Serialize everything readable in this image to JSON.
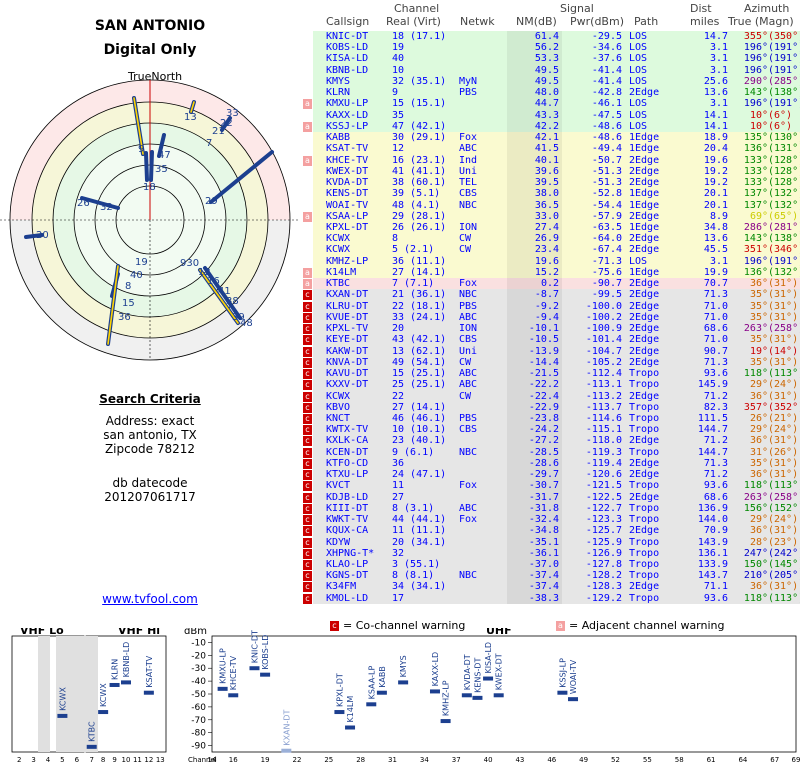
{
  "left": {
    "title": "SAN ANTONIO",
    "subtitle": "Digital Only",
    "true_north": "TrueNorth",
    "n_label": "N",
    "search_criteria_label": "Search Criteria",
    "address_line": "Address: exact",
    "city_line": "san antonio, TX",
    "zip_line": "Zipcode 78212",
    "db_label": "db datecode",
    "db_value": "201207061717",
    "link": "www.tvfool.com"
  },
  "polar": {
    "labels": [
      "13",
      "33",
      "22",
      "21",
      "7",
      "9",
      "47",
      "35",
      "18",
      "29",
      "26",
      "32",
      "20",
      "19",
      "40",
      "8",
      "15",
      "36",
      "930",
      "12",
      "16",
      "41",
      "38",
      "39",
      "48"
    ]
  },
  "header": {
    "channel": "Channel",
    "signal": "Signal",
    "dist": "Dist",
    "azimuth": "Azimuth",
    "callsign": "Callsign",
    "real_virt": "Real (Virt)",
    "netwk": "Netwk",
    "nm": "NM(dB)",
    "pwr": "Pwr(dBm)",
    "path": "Path",
    "miles": "miles",
    "true_magn": "True (Magn)"
  },
  "colors": {
    "green": "#ddfadd",
    "yellow": "#fafad0",
    "pink": "#fae0e0",
    "gray": "#e6e6e6",
    "warn_c": "#cc0000",
    "warn_a": "#f4a0a0"
  },
  "rows": [
    {
      "w": "",
      "bg": "green",
      "cs": "KNIC-DT",
      "ch": "18 (17.1)",
      "nw": "",
      "nm": "61.4",
      "pw": "-29.5",
      "pt": "LOS",
      "mi": "14.7",
      "az": "355°",
      "mg": "(350°)",
      "azc": "#c00"
    },
    {
      "w": "",
      "bg": "green",
      "cs": "KOBS-LD",
      "ch": "19",
      "nw": "",
      "nm": "56.2",
      "pw": "-34.6",
      "pt": "LOS",
      "mi": "3.1",
      "az": "196°",
      "mg": "(191°)",
      "azc": "#00c"
    },
    {
      "w": "",
      "bg": "green",
      "cs": "KISA-LD",
      "ch": "40",
      "nw": "",
      "nm": "53.3",
      "pw": "-37.6",
      "pt": "LOS",
      "mi": "3.1",
      "az": "196°",
      "mg": "(191°)",
      "azc": "#00c"
    },
    {
      "w": "",
      "bg": "green",
      "cs": "KBNB-LD",
      "ch": "10",
      "nw": "",
      "nm": "49.5",
      "pw": "-41.4",
      "pt": "LOS",
      "mi": "3.1",
      "az": "196°",
      "mg": "(191°)",
      "azc": "#00c"
    },
    {
      "w": "",
      "bg": "green",
      "cs": "KMYS",
      "ch": "32 (35.1)",
      "nw": "MyN",
      "nm": "49.5",
      "pw": "-41.4",
      "pt": "LOS",
      "mi": "25.6",
      "az": "290°",
      "mg": "(285°)",
      "azc": "#808"
    },
    {
      "w": "",
      "bg": "green",
      "cs": "KLRN",
      "ch": "9",
      "nw": "PBS",
      "nm": "48.0",
      "pw": "-42.8",
      "pt": "2Edge",
      "mi": "13.6",
      "az": "143°",
      "mg": "(138°)",
      "azc": "#080"
    },
    {
      "w": "a",
      "bg": "green",
      "cs": "KMXU-LP",
      "ch": "15 (15.1)",
      "nw": "",
      "nm": "44.7",
      "pw": "-46.1",
      "pt": "LOS",
      "mi": "3.1",
      "az": "196°",
      "mg": "(191°)",
      "azc": "#00c"
    },
    {
      "w": "",
      "bg": "green",
      "cs": "KAXX-LD",
      "ch": "35",
      "nw": "",
      "nm": "43.3",
      "pw": "-47.5",
      "pt": "LOS",
      "mi": "14.1",
      "az": "10°",
      "mg": "(6°)",
      "azc": "#c00"
    },
    {
      "w": "a",
      "bg": "green",
      "cs": "KSSJ-LP",
      "ch": "47 (42.1)",
      "nw": "",
      "nm": "42.2",
      "pw": "-48.6",
      "pt": "LOS",
      "mi": "14.1",
      "az": "10°",
      "mg": "(6°)",
      "azc": "#c00"
    },
    {
      "w": "",
      "bg": "yellow",
      "cs": "KABB",
      "ch": "30 (29.1)",
      "nw": "Fox",
      "nm": "42.1",
      "pw": "-48.6",
      "pt": "1Edge",
      "mi": "18.9",
      "az": "135°",
      "mg": "(130°)",
      "azc": "#080"
    },
    {
      "w": "",
      "bg": "yellow",
      "cs": "KSAT-TV",
      "ch": "12",
      "nw": "ABC",
      "nm": "41.5",
      "pw": "-49.4",
      "pt": "1Edge",
      "mi": "20.4",
      "az": "136°",
      "mg": "(131°)",
      "azc": "#080"
    },
    {
      "w": "a",
      "bg": "yellow",
      "cs": "KHCE-TV",
      "ch": "16 (23.1)",
      "nw": "Ind",
      "nm": "40.1",
      "pw": "-50.7",
      "pt": "2Edge",
      "mi": "19.6",
      "az": "133°",
      "mg": "(128°)",
      "azc": "#080"
    },
    {
      "w": "",
      "bg": "yellow",
      "cs": "KWEX-DT",
      "ch": "41 (41.1)",
      "nw": "Uni",
      "nm": "39.6",
      "pw": "-51.3",
      "pt": "2Edge",
      "mi": "19.2",
      "az": "133°",
      "mg": "(128°)",
      "azc": "#080"
    },
    {
      "w": "",
      "bg": "yellow",
      "cs": "KVDA-DT",
      "ch": "38 (60.1)",
      "nw": "TEL",
      "nm": "39.5",
      "pw": "-51.3",
      "pt": "2Edge",
      "mi": "19.2",
      "az": "133°",
      "mg": "(128°)",
      "azc": "#080"
    },
    {
      "w": "",
      "bg": "yellow",
      "cs": "KENS-DT",
      "ch": "39 (5.1)",
      "nw": "CBS",
      "nm": "38.0",
      "pw": "-52.8",
      "pt": "1Edge",
      "mi": "20.1",
      "az": "137°",
      "mg": "(132°)",
      "azc": "#080"
    },
    {
      "w": "",
      "bg": "yellow",
      "cs": "WOAI-TV",
      "ch": "48 (4.1)",
      "nw": "NBC",
      "nm": "36.5",
      "pw": "-54.4",
      "pt": "1Edge",
      "mi": "20.1",
      "az": "137°",
      "mg": "(132°)",
      "azc": "#080"
    },
    {
      "w": "a",
      "bg": "yellow",
      "cs": "KSAA-LP",
      "ch": "29 (28.1)",
      "nw": "",
      "nm": "33.0",
      "pw": "-57.9",
      "pt": "2Edge",
      "mi": "8.9",
      "az": "69°",
      "mg": "(65°)",
      "azc": "#cc0"
    },
    {
      "w": "",
      "bg": "yellow",
      "cs": "KPXL-DT",
      "ch": "26 (26.1)",
      "nw": "ION",
      "nm": "27.4",
      "pw": "-63.5",
      "pt": "1Edge",
      "mi": "34.8",
      "az": "286°",
      "mg": "(281°)",
      "azc": "#808"
    },
    {
      "w": "",
      "bg": "yellow",
      "cs": "KCWX",
      "ch": "8",
      "nw": "CW",
      "nm": "26.9",
      "pw": "-64.0",
      "pt": "2Edge",
      "mi": "13.6",
      "az": "143°",
      "mg": "(138°)",
      "azc": "#080"
    },
    {
      "w": "",
      "bg": "yellow",
      "cs": "KCWX",
      "ch": "5 (2.1)",
      "nw": "CW",
      "nm": "23.4",
      "pw": "-67.4",
      "pt": "2Edge",
      "mi": "45.5",
      "az": "351°",
      "mg": "(346°)",
      "azc": "#c00"
    },
    {
      "w": "",
      "bg": "yellow",
      "cs": "KMHZ-LP",
      "ch": "36 (11.1)",
      "nw": "",
      "nm": "19.6",
      "pw": "-71.3",
      "pt": "LOS",
      "mi": "3.1",
      "az": "196°",
      "mg": "(191°)",
      "azc": "#00c"
    },
    {
      "w": "a",
      "bg": "yellow",
      "cs": "K14LM",
      "ch": "27 (14.1)",
      "nw": "",
      "nm": "15.2",
      "pw": "-75.6",
      "pt": "1Edge",
      "mi": "19.9",
      "az": "136°",
      "mg": "(132°)",
      "azc": "#080"
    },
    {
      "w": "a",
      "bg": "pink",
      "cs": "KTBC",
      "ch": "7 (7.1)",
      "nw": "Fox",
      "nm": "0.2",
      "pw": "-90.7",
      "pt": "2Edge",
      "mi": "70.7",
      "az": "36°",
      "mg": "(31°)",
      "azc": "#c60"
    },
    {
      "w": "c",
      "bg": "gray",
      "cs": "KXAN-DT",
      "ch": "21 (36.1)",
      "nw": "NBC",
      "nm": "-8.7",
      "pw": "-99.5",
      "pt": "2Edge",
      "mi": "71.3",
      "az": "35°",
      "mg": "(31°)",
      "azc": "#c60"
    },
    {
      "w": "c",
      "bg": "gray",
      "cs": "KLRU-DT",
      "ch": "22 (18.1)",
      "nw": "PBS",
      "nm": "-9.2",
      "pw": "-100.0",
      "pt": "2Edge",
      "mi": "71.0",
      "az": "35°",
      "mg": "(31°)",
      "azc": "#c60"
    },
    {
      "w": "c",
      "bg": "gray",
      "cs": "KVUE-DT",
      "ch": "33 (24.1)",
      "nw": "ABC",
      "nm": "-9.4",
      "pw": "-100.2",
      "pt": "2Edge",
      "mi": "71.0",
      "az": "35°",
      "mg": "(31°)",
      "azc": "#c60"
    },
    {
      "w": "c",
      "bg": "gray",
      "cs": "KPXL-TV",
      "ch": "20",
      "nw": "ION",
      "nm": "-10.1",
      "pw": "-100.9",
      "pt": "2Edge",
      "mi": "68.6",
      "az": "263°",
      "mg": "(258°)",
      "azc": "#808"
    },
    {
      "w": "c",
      "bg": "gray",
      "cs": "KEYE-DT",
      "ch": "43 (42.1)",
      "nw": "CBS",
      "nm": "-10.5",
      "pw": "-101.4",
      "pt": "2Edge",
      "mi": "71.0",
      "az": "35°",
      "mg": "(31°)",
      "azc": "#c60"
    },
    {
      "w": "c",
      "bg": "gray",
      "cs": "KAKW-DT",
      "ch": "13 (62.1)",
      "nw": "Uni",
      "nm": "-13.9",
      "pw": "-104.7",
      "pt": "2Edge",
      "mi": "90.7",
      "az": "19°",
      "mg": "(14°)",
      "azc": "#c00"
    },
    {
      "w": "c",
      "bg": "gray",
      "cs": "KNVA-DT",
      "ch": "49 (54.1)",
      "nw": "CW",
      "nm": "-14.4",
      "pw": "-105.2",
      "pt": "2Edge",
      "mi": "71.3",
      "az": "35°",
      "mg": "(31°)",
      "azc": "#c60"
    },
    {
      "w": "c",
      "bg": "gray",
      "cs": "KAVU-DT",
      "ch": "15 (25.1)",
      "nw": "ABC",
      "nm": "-21.5",
      "pw": "-112.4",
      "pt": "Tropo",
      "mi": "93.6",
      "az": "118°",
      "mg": "(113°)",
      "azc": "#080"
    },
    {
      "w": "c",
      "bg": "gray",
      "cs": "KXXV-DT",
      "ch": "25 (25.1)",
      "nw": "ABC",
      "nm": "-22.2",
      "pw": "-113.1",
      "pt": "Tropo",
      "mi": "145.9",
      "az": "29°",
      "mg": "(24°)",
      "azc": "#c60"
    },
    {
      "w": "c",
      "bg": "gray",
      "cs": "KCWX",
      "ch": "22",
      "nw": "CW",
      "nm": "-22.4",
      "pw": "-113.2",
      "pt": "2Edge",
      "mi": "71.2",
      "az": "36°",
      "mg": "(31°)",
      "azc": "#c60"
    },
    {
      "w": "c",
      "bg": "gray",
      "cs": "KBVO",
      "ch": "27 (14.1)",
      "nw": "",
      "nm": "-22.9",
      "pw": "-113.7",
      "pt": "Tropo",
      "mi": "82.3",
      "az": "357°",
      "mg": "(352°)",
      "azc": "#c00"
    },
    {
      "w": "c",
      "bg": "gray",
      "cs": "KNCT",
      "ch": "46 (46.1)",
      "nw": "PBS",
      "nm": "-23.8",
      "pw": "-114.6",
      "pt": "Tropo",
      "mi": "111.5",
      "az": "26°",
      "mg": "(21°)",
      "azc": "#c60"
    },
    {
      "w": "c",
      "bg": "gray",
      "cs": "KWTX-TV",
      "ch": "10 (10.1)",
      "nw": "CBS",
      "nm": "-24.2",
      "pw": "-115.1",
      "pt": "Tropo",
      "mi": "144.7",
      "az": "29°",
      "mg": "(24°)",
      "azc": "#c60"
    },
    {
      "w": "c",
      "bg": "gray",
      "cs": "KXLK-CA",
      "ch": "23 (40.1)",
      "nw": "",
      "nm": "-27.2",
      "pw": "-118.0",
      "pt": "2Edge",
      "mi": "71.2",
      "az": "36°",
      "mg": "(31°)",
      "azc": "#c60"
    },
    {
      "w": "c",
      "bg": "gray",
      "cs": "KCEN-DT",
      "ch": "9 (6.1)",
      "nw": "NBC",
      "nm": "-28.5",
      "pw": "-119.3",
      "pt": "Tropo",
      "mi": "144.7",
      "az": "31°",
      "mg": "(26°)",
      "azc": "#c60"
    },
    {
      "w": "c",
      "bg": "gray",
      "cs": "KTFO-CD",
      "ch": "36",
      "nw": "",
      "nm": "-28.6",
      "pw": "-119.4",
      "pt": "2Edge",
      "mi": "71.3",
      "az": "35°",
      "mg": "(31°)",
      "azc": "#c60"
    },
    {
      "w": "c",
      "bg": "gray",
      "cs": "KTXU-LP",
      "ch": "24 (47.1)",
      "nw": "",
      "nm": "-29.7",
      "pw": "-120.6",
      "pt": "2Edge",
      "mi": "71.2",
      "az": "36°",
      "mg": "(31°)",
      "azc": "#c60"
    },
    {
      "w": "c",
      "bg": "gray",
      "cs": "KVCT",
      "ch": "11",
      "nw": "Fox",
      "nm": "-30.7",
      "pw": "-121.5",
      "pt": "Tropo",
      "mi": "93.6",
      "az": "118°",
      "mg": "(113°)",
      "azc": "#080"
    },
    {
      "w": "c",
      "bg": "gray",
      "cs": "KDJB-LD",
      "ch": "27",
      "nw": "",
      "nm": "-31.7",
      "pw": "-122.5",
      "pt": "2Edge",
      "mi": "68.6",
      "az": "263°",
      "mg": "(258°)",
      "azc": "#808"
    },
    {
      "w": "c",
      "bg": "gray",
      "cs": "KIII-DT",
      "ch": "8 (3.1)",
      "nw": "ABC",
      "nm": "-31.8",
      "pw": "-122.7",
      "pt": "Tropo",
      "mi": "136.9",
      "az": "156°",
      "mg": "(152°)",
      "azc": "#080"
    },
    {
      "w": "c",
      "bg": "gray",
      "cs": "KWKT-TV",
      "ch": "44 (44.1)",
      "nw": "Fox",
      "nm": "-32.4",
      "pw": "-123.3",
      "pt": "Tropo",
      "mi": "144.0",
      "az": "29°",
      "mg": "(24°)",
      "azc": "#c60"
    },
    {
      "w": "c",
      "bg": "gray",
      "cs": "KQUX-CA",
      "ch": "11 (11.1)",
      "nw": "",
      "nm": "-34.8",
      "pw": "-125.7",
      "pt": "2Edge",
      "mi": "70.9",
      "az": "36°",
      "mg": "(31°)",
      "azc": "#c60"
    },
    {
      "w": "c",
      "bg": "gray",
      "cs": "KDYW",
      "ch": "20 (34.1)",
      "nw": "",
      "nm": "-35.1",
      "pw": "-125.9",
      "pt": "Tropo",
      "mi": "143.9",
      "az": "28°",
      "mg": "(23°)",
      "azc": "#c60"
    },
    {
      "w": "c",
      "bg": "gray",
      "cs": "XHPNG-T*",
      "ch": "32",
      "nw": "",
      "nm": "-36.1",
      "pw": "-126.9",
      "pt": "Tropo",
      "mi": "136.1",
      "az": "247°",
      "mg": "(242°)",
      "azc": "#00c"
    },
    {
      "w": "c",
      "bg": "gray",
      "cs": "KLAO-LP",
      "ch": "3 (55.1)",
      "nw": "",
      "nm": "-37.0",
      "pw": "-127.8",
      "pt": "Tropo",
      "mi": "133.9",
      "az": "150°",
      "mg": "(145°)",
      "azc": "#080"
    },
    {
      "w": "c",
      "bg": "gray",
      "cs": "KGNS-DT",
      "ch": "8 (8.1)",
      "nw": "NBC",
      "nm": "-37.4",
      "pw": "-128.2",
      "pt": "Tropo",
      "mi": "143.7",
      "az": "210°",
      "mg": "(205°)",
      "azc": "#00c"
    },
    {
      "w": "c",
      "bg": "gray",
      "cs": "K34FM",
      "ch": "34 (34.1)",
      "nw": "",
      "nm": "-37.4",
      "pw": "-128.3",
      "pt": "2Edge",
      "mi": "71.1",
      "az": "36°",
      "mg": "(31°)",
      "azc": "#c60"
    },
    {
      "w": "c",
      "bg": "gray",
      "cs": "KMOL-LD",
      "ch": "17",
      "nw": "",
      "nm": "-38.3",
      "pw": "-129.2",
      "pt": "Tropo",
      "mi": "93.6",
      "az": "118°",
      "mg": "(113°)",
      "azc": "#080"
    }
  ],
  "legend": {
    "co_channel": "= Co-channel warning",
    "adjacent": "= Adjacent channel warning",
    "c": "c",
    "a": "a"
  },
  "bottom": {
    "vhf_lo": "VHF Lo",
    "vhf_hi": "VHF Hi",
    "uhf": "UHF",
    "dbm": "dBm",
    "channel": "Channel",
    "y_ticks": [
      "-10",
      "-20",
      "-30",
      "-40",
      "-50",
      "-60",
      "-70",
      "-80",
      "-90"
    ],
    "vhf_lo_ticks": [
      "2",
      "3",
      "4",
      "5",
      "6"
    ],
    "vhf_hi_ticks": [
      "7",
      "8",
      "9",
      "10",
      "11",
      "12",
      "13"
    ],
    "uhf_ticks": [
      "14",
      "16",
      "19",
      "22",
      "25",
      "28",
      "31",
      "34",
      "37",
      "40",
      "43",
      "46",
      "49",
      "52",
      "55",
      "58",
      "61",
      "64",
      "67",
      "69"
    ]
  },
  "chart_data": {
    "type": "scatter",
    "title": "",
    "xlabel": "Channel",
    "ylabel": "dBm",
    "ylim": [
      -95,
      -5
    ],
    "points": [
      {
        "name": "KCWX",
        "ch": 5,
        "dbm": -67
      },
      {
        "name": "KTBC",
        "ch": 7,
        "dbm": -91
      },
      {
        "name": "KCWX",
        "ch": 8,
        "dbm": -64
      },
      {
        "name": "KLRN",
        "ch": 9,
        "dbm": -43
      },
      {
        "name": "KBNB-LD",
        "ch": 10,
        "dbm": -41
      },
      {
        "name": "KSAT-TV",
        "ch": 12,
        "dbm": -49
      },
      {
        "name": "KMXU-LP",
        "ch": 15,
        "dbm": -46
      },
      {
        "name": "KHCE-TV",
        "ch": 16,
        "dbm": -51
      },
      {
        "name": "KNIC-DT",
        "ch": 18,
        "dbm": -30
      },
      {
        "name": "KOBS-LD",
        "ch": 19,
        "dbm": -35
      },
      {
        "name": "KXAN-DT",
        "ch": 21,
        "dbm": -100
      },
      {
        "name": "KPXL-DT",
        "ch": 26,
        "dbm": -64
      },
      {
        "name": "K14LM",
        "ch": 27,
        "dbm": -76
      },
      {
        "name": "KSAA-LP",
        "ch": 29,
        "dbm": -58
      },
      {
        "name": "KABB",
        "ch": 30,
        "dbm": -49
      },
      {
        "name": "KMYS",
        "ch": 32,
        "dbm": -41
      },
      {
        "name": "KAXX-LD",
        "ch": 35,
        "dbm": -48
      },
      {
        "name": "KMHZ-LP",
        "ch": 36,
        "dbm": -71
      },
      {
        "name": "KVDA-DT",
        "ch": 38,
        "dbm": -51
      },
      {
        "name": "KENS-DT",
        "ch": 39,
        "dbm": -53
      },
      {
        "name": "KISA-LD",
        "ch": 40,
        "dbm": -38
      },
      {
        "name": "KWEX-DT",
        "ch": 41,
        "dbm": -51
      },
      {
        "name": "KSSJ-LP",
        "ch": 47,
        "dbm": -49
      },
      {
        "name": "WOAI-TV",
        "ch": 48,
        "dbm": -54
      }
    ]
  }
}
